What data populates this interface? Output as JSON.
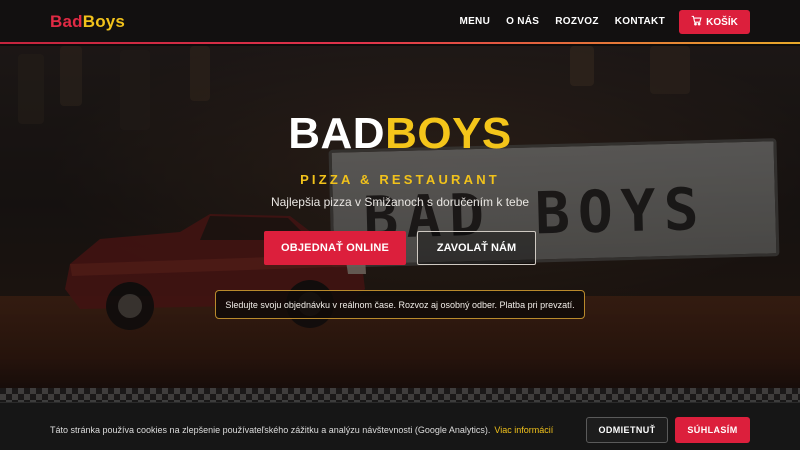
{
  "header": {
    "logo": {
      "part1": "Bad",
      "part2": "Boys"
    },
    "nav": [
      {
        "label": "MENU"
      },
      {
        "label": "O NÁS"
      },
      {
        "label": "ROZVOZ"
      },
      {
        "label": "KONTAKT"
      }
    ],
    "cart": {
      "label": "KOŠÍK",
      "icon": "cart-icon"
    }
  },
  "hero": {
    "title_white": "BAD",
    "title_yellow": "BOYS",
    "subtitle": "PIZZA & RESTAURANT",
    "tagline": "Najlepšia pizza v Smižanoch s doručením k tebe",
    "primary_button": "OBJEDNAŤ ONLINE",
    "secondary_button": "ZAVOLAŤ NÁM",
    "info": "Sledujte svoju objednávku v reálnom čase. Rozvoz aj osobný odber. Platba pri prevzatí."
  },
  "cookies": {
    "text": "Táto stránka používa cookies na zlepšenie používateľského zážitku a analýzu návštevnosti (Google Analytics).",
    "link": "Viac informácií",
    "reject": "ODMIETNUŤ",
    "accept": "SÚHLASÍM"
  },
  "colors": {
    "brand_red": "#dc1f3c",
    "brand_yellow": "#f1c21b",
    "header_bg": "#121010"
  }
}
